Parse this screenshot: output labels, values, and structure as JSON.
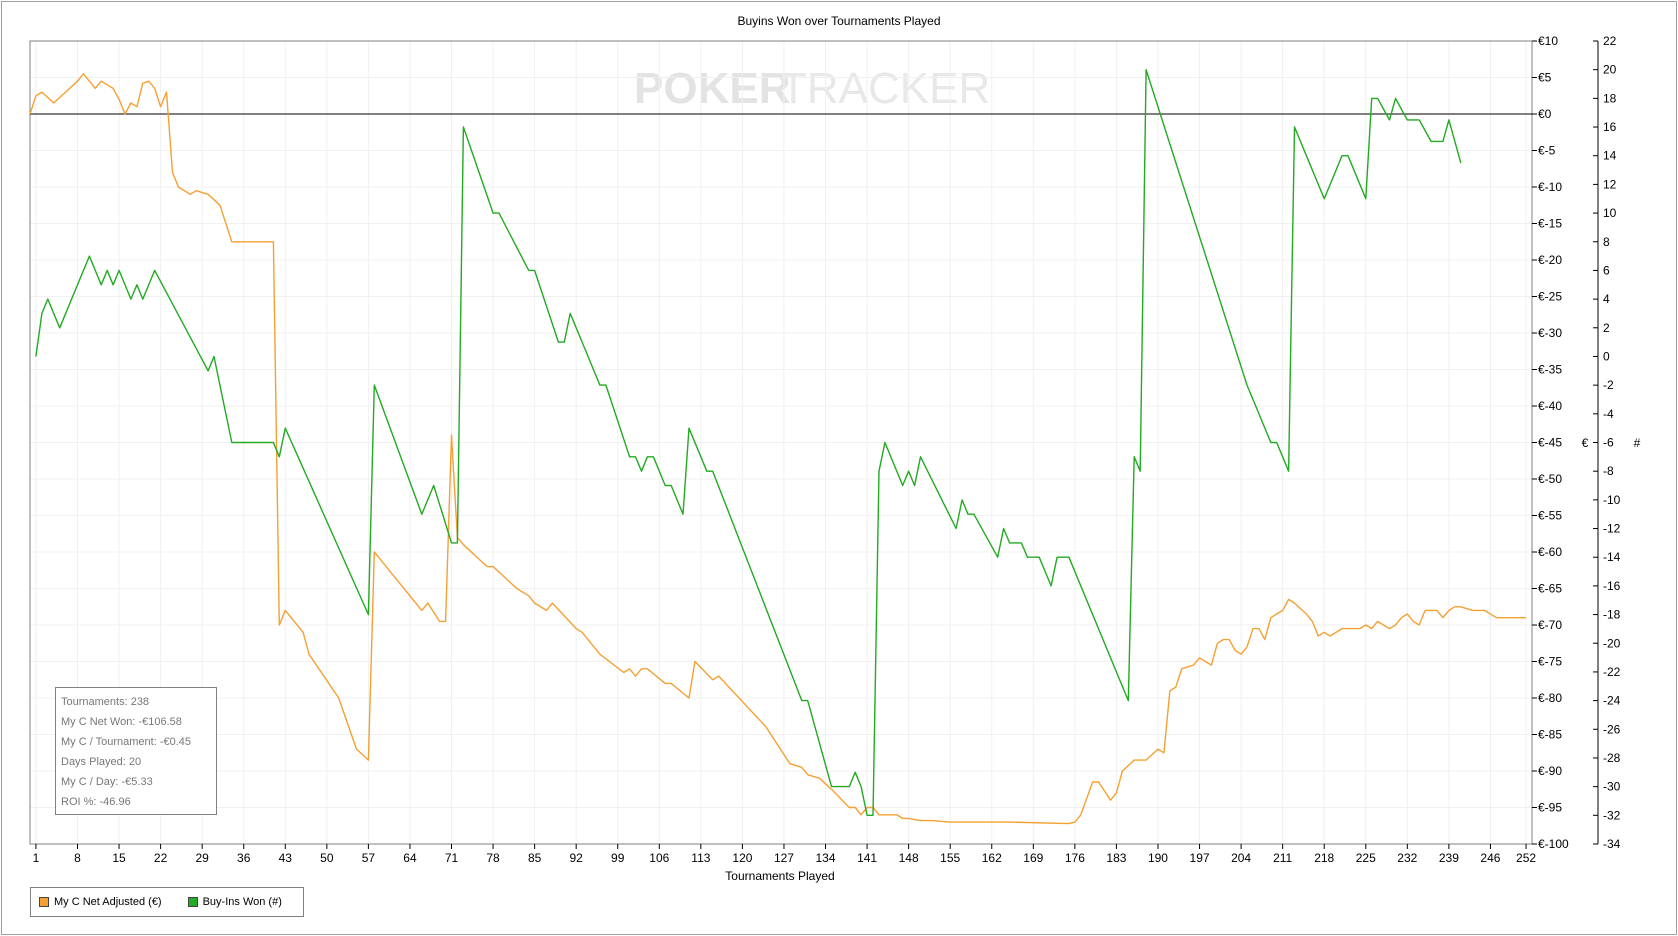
{
  "chart_data": {
    "type": "line",
    "title": "Buyins Won over Tournaments Played",
    "xlabel": "Tournaments Played",
    "ylabel_left": "€",
    "ylabel_right": "#",
    "watermark_left": "POKER",
    "watermark_right": "TRACKER",
    "xlim": [
      0,
      253
    ],
    "x_ticks": [
      "1",
      "8",
      "15",
      "22",
      "29",
      "36",
      "43",
      "50",
      "57",
      "64",
      "71",
      "78",
      "85",
      "92",
      "99",
      "106",
      "113",
      "120",
      "127",
      "134",
      "141",
      "148",
      "155",
      "162",
      "169",
      "176",
      "183",
      "190",
      "197",
      "204",
      "211",
      "218",
      "225",
      "232",
      "239",
      "246",
      "252"
    ],
    "y_left_lim": [
      -100,
      10
    ],
    "y_left_ticks": [
      "€10",
      "€5",
      "€0",
      "€-5",
      "€-10",
      "€-15",
      "€-20",
      "€-25",
      "€-30",
      "€-35",
      "€-40",
      "€-45",
      "€-50",
      "€-55",
      "€-60",
      "€-65",
      "€-70",
      "€-75",
      "€-80",
      "€-85",
      "€-90",
      "€-95",
      "€-100"
    ],
    "y_right_lim": [
      -34,
      22
    ],
    "y_right_ticks": [
      "22",
      "20",
      "18",
      "16",
      "14",
      "12",
      "10",
      "8",
      "6",
      "4",
      "2",
      "0",
      "-2",
      "-4",
      "-6",
      "-8",
      "-10",
      "-12",
      "-14",
      "-16",
      "-18",
      "-20",
      "-22",
      "-24",
      "-26",
      "-28",
      "-30",
      "-32",
      "-34"
    ],
    "zero_line": 0,
    "series": [
      {
        "name": "My C Net Adjusted (€)",
        "axis": "left",
        "color": "#f5a033",
        "points": [
          [
            0,
            0
          ],
          [
            1,
            2.5
          ],
          [
            2,
            3
          ],
          [
            4,
            1.5
          ],
          [
            6,
            3
          ],
          [
            8,
            4.5
          ],
          [
            9,
            5.5
          ],
          [
            10,
            4.5
          ],
          [
            11,
            3.5
          ],
          [
            12,
            4.5
          ],
          [
            13,
            4
          ],
          [
            14,
            3.5
          ],
          [
            15,
            2
          ],
          [
            16,
            0
          ],
          [
            17,
            1.5
          ],
          [
            18,
            1
          ],
          [
            19,
            4.2
          ],
          [
            20,
            4.5
          ],
          [
            21,
            3.5
          ],
          [
            22,
            1
          ],
          [
            23,
            3
          ],
          [
            24,
            -8
          ],
          [
            25,
            -10
          ],
          [
            27,
            -11
          ],
          [
            28,
            -10.5
          ],
          [
            30,
            -11
          ],
          [
            32,
            -12.5
          ],
          [
            34,
            -17.5
          ],
          [
            41,
            -17.5
          ],
          [
            42,
            -70
          ],
          [
            43,
            -68
          ],
          [
            46,
            -71
          ],
          [
            47,
            -74
          ],
          [
            52,
            -80
          ],
          [
            55,
            -87
          ],
          [
            57,
            -88.5
          ],
          [
            58,
            -60
          ],
          [
            66,
            -68
          ],
          [
            67,
            -67
          ],
          [
            69,
            -69.5
          ],
          [
            70,
            -69.5
          ],
          [
            71,
            -44
          ],
          [
            72,
            -58
          ],
          [
            73,
            -59
          ],
          [
            77,
            -62
          ],
          [
            78,
            -62
          ],
          [
            82,
            -65
          ],
          [
            84,
            -66
          ],
          [
            85,
            -67
          ],
          [
            87,
            -68
          ],
          [
            88,
            -67
          ],
          [
            92,
            -70.5
          ],
          [
            93,
            -71
          ],
          [
            96,
            -74
          ],
          [
            100,
            -76.5
          ],
          [
            101,
            -76
          ],
          [
            102,
            -77
          ],
          [
            103,
            -76
          ],
          [
            104,
            -76
          ],
          [
            107,
            -78
          ],
          [
            108,
            -78
          ],
          [
            111,
            -80
          ],
          [
            112,
            -75
          ],
          [
            115,
            -77.5
          ],
          [
            116,
            -77
          ],
          [
            124,
            -84
          ],
          [
            128,
            -89
          ],
          [
            130,
            -89.5
          ],
          [
            131,
            -90.5
          ],
          [
            133,
            -91
          ],
          [
            135,
            -92.5
          ],
          [
            138,
            -95
          ],
          [
            139,
            -95
          ],
          [
            140,
            -96
          ],
          [
            141,
            -95
          ],
          [
            142,
            -95
          ],
          [
            143,
            -96
          ],
          [
            146,
            -96
          ],
          [
            147,
            -96.5
          ],
          [
            148,
            -96.5
          ],
          [
            150,
            -96.8
          ],
          [
            152,
            -96.8
          ],
          [
            155,
            -97
          ],
          [
            165,
            -97
          ],
          [
            175,
            -97.2
          ],
          [
            176,
            -97
          ],
          [
            177,
            -96
          ],
          [
            179,
            -91.5
          ],
          [
            180,
            -91.5
          ],
          [
            182,
            -94
          ],
          [
            183,
            -93
          ],
          [
            184,
            -90
          ],
          [
            186,
            -88.5
          ],
          [
            188,
            -88.5
          ],
          [
            190,
            -87
          ],
          [
            191,
            -87.5
          ],
          [
            192,
            -79
          ],
          [
            193,
            -78.5
          ],
          [
            194,
            -76
          ],
          [
            196,
            -75.5
          ],
          [
            197,
            -74.5
          ],
          [
            198,
            -75
          ],
          [
            199,
            -75.5
          ],
          [
            200,
            -72.5
          ],
          [
            201,
            -72
          ],
          [
            202,
            -72
          ],
          [
            203,
            -73.5
          ],
          [
            204,
            -74
          ],
          [
            205,
            -73
          ],
          [
            206,
            -70.5
          ],
          [
            207,
            -70.5
          ],
          [
            208,
            -72
          ],
          [
            209,
            -69
          ],
          [
            210,
            -68.5
          ],
          [
            211,
            -68
          ],
          [
            212,
            -66.5
          ],
          [
            213,
            -67
          ],
          [
            215,
            -68.5
          ],
          [
            216,
            -69.5
          ],
          [
            217,
            -71.5
          ],
          [
            218,
            -71
          ],
          [
            219,
            -71.5
          ],
          [
            221,
            -70.5
          ],
          [
            224,
            -70.5
          ],
          [
            225,
            -70
          ],
          [
            226,
            -70.5
          ],
          [
            227,
            -69.5
          ],
          [
            228,
            -70
          ],
          [
            229,
            -70.5
          ],
          [
            230,
            -70
          ],
          [
            231,
            -69
          ],
          [
            232,
            -68.5
          ],
          [
            233,
            -69.5
          ],
          [
            234,
            -70
          ],
          [
            235,
            -68
          ],
          [
            236,
            -68
          ],
          [
            237,
            -68
          ],
          [
            238,
            -69
          ],
          [
            239,
            -68
          ],
          [
            240,
            -67.5
          ],
          [
            241,
            -67.5
          ],
          [
            243,
            -68
          ],
          [
            245,
            -68
          ],
          [
            247,
            -69
          ],
          [
            248,
            -69
          ],
          [
            252,
            -69
          ]
        ]
      },
      {
        "name": "Buy-Ins Won (#)",
        "axis": "right",
        "color": "#22aa22",
        "points": [
          [
            1,
            0
          ],
          [
            2,
            3
          ],
          [
            3,
            4
          ],
          [
            5,
            2
          ],
          [
            10,
            7
          ],
          [
            12,
            5
          ],
          [
            13,
            6
          ],
          [
            14,
            5
          ],
          [
            15,
            6
          ],
          [
            17,
            4
          ],
          [
            18,
            5
          ],
          [
            19,
            4
          ],
          [
            21,
            6
          ],
          [
            30,
            -1
          ],
          [
            31,
            0
          ],
          [
            34,
            -6
          ],
          [
            41,
            -6
          ],
          [
            42,
            -7
          ],
          [
            43,
            -5
          ],
          [
            57,
            -18
          ],
          [
            58,
            -2
          ],
          [
            66,
            -11
          ],
          [
            68,
            -9
          ],
          [
            71,
            -13
          ],
          [
            72,
            -13
          ],
          [
            73,
            16
          ],
          [
            78,
            10
          ],
          [
            79,
            10
          ],
          [
            84,
            6
          ],
          [
            85,
            6
          ],
          [
            89,
            1
          ],
          [
            90,
            1
          ],
          [
            91,
            3
          ],
          [
            96,
            -2
          ],
          [
            97,
            -2
          ],
          [
            101,
            -7
          ],
          [
            102,
            -7
          ],
          [
            103,
            -8
          ],
          [
            104,
            -7
          ],
          [
            105,
            -7
          ],
          [
            107,
            -9
          ],
          [
            108,
            -9
          ],
          [
            110,
            -11
          ],
          [
            111,
            -5
          ],
          [
            114,
            -8
          ],
          [
            115,
            -8
          ],
          [
            130,
            -24
          ],
          [
            131,
            -24
          ],
          [
            135,
            -30
          ],
          [
            138,
            -30
          ],
          [
            139,
            -29
          ],
          [
            140,
            -30
          ],
          [
            141,
            -32
          ],
          [
            142,
            -32
          ],
          [
            143,
            -8
          ],
          [
            144,
            -6
          ],
          [
            147,
            -9
          ],
          [
            148,
            -8
          ],
          [
            149,
            -9
          ],
          [
            150,
            -7
          ],
          [
            156,
            -12
          ],
          [
            157,
            -10
          ],
          [
            158,
            -11
          ],
          [
            159,
            -11
          ],
          [
            163,
            -14
          ],
          [
            164,
            -12
          ],
          [
            165,
            -13
          ],
          [
            167,
            -13
          ],
          [
            168,
            -14
          ],
          [
            170,
            -14
          ],
          [
            172,
            -16
          ],
          [
            173,
            -14
          ],
          [
            174,
            -14
          ],
          [
            175,
            -14
          ],
          [
            185,
            -24
          ],
          [
            186,
            -7
          ],
          [
            187,
            -8
          ],
          [
            188,
            20
          ],
          [
            205,
            -2
          ],
          [
            206,
            -3
          ],
          [
            209,
            -6
          ],
          [
            210,
            -6
          ],
          [
            212,
            -8
          ],
          [
            213,
            16
          ],
          [
            215,
            14
          ],
          [
            217,
            12
          ],
          [
            218,
            11
          ],
          [
            219,
            12
          ],
          [
            221,
            14
          ],
          [
            222,
            14
          ],
          [
            225,
            11
          ],
          [
            226,
            18
          ],
          [
            227,
            18
          ],
          [
            229,
            16.5
          ],
          [
            230,
            18
          ],
          [
            232,
            16.5
          ],
          [
            234,
            16.5
          ],
          [
            236,
            15
          ],
          [
            238,
            15
          ],
          [
            239,
            16.5
          ],
          [
            241,
            13.5
          ]
        ]
      }
    ]
  },
  "stats": [
    "Tournaments: 238",
    "My C Net Won: -€106.58",
    "My C / Tournament: -€0.45",
    "Days Played: 20",
    "My C / Day: -€5.33",
    "ROI %: -46.96"
  ],
  "legend": [
    {
      "label": "My C Net Adjusted (€)",
      "color": "#f5a033"
    },
    {
      "label": "Buy-Ins Won (#)",
      "color": "#22aa22"
    }
  ]
}
